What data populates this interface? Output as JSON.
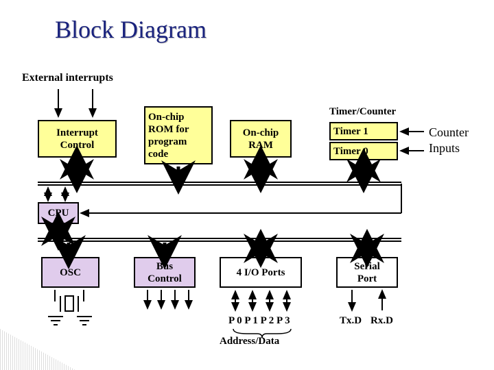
{
  "title": "Block Diagram",
  "labels": {
    "ext_int": "External interrupts",
    "counter_inputs_1": "Counter",
    "counter_inputs_2": "Inputs",
    "timer_counter": "Timer/Counter",
    "cpu": "CPU",
    "p_ports": "P 0 P 1 P 2 P 3",
    "addr_data": "Address/Data",
    "txd": "Tx.D",
    "rxd": "Rx.D"
  },
  "blocks": {
    "interrupt_control": "Interrupt\nControl",
    "rom": "On-chip\nROM for\nprogram\ncode",
    "ram": "On-chip\nRAM",
    "timer1": "Timer 1",
    "timer0": "Timer 0",
    "osc": "OSC",
    "bus_control": "Bus\nControl",
    "io_ports": "4 I/O Ports",
    "serial_port": "Serial\nPort"
  }
}
